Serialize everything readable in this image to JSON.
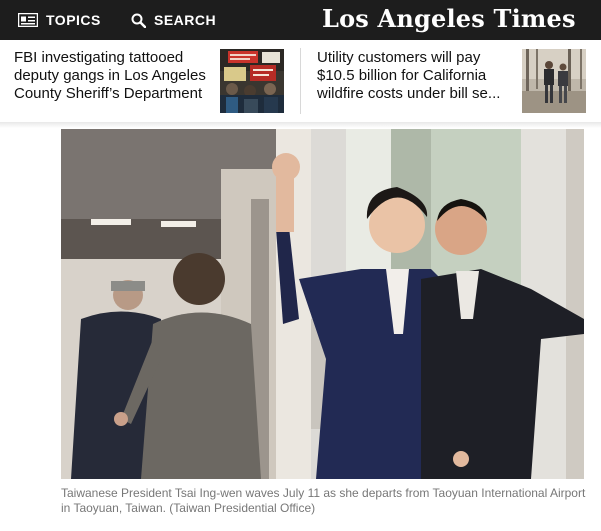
{
  "nav": {
    "topics_label": "TOPICS",
    "search_label": "SEARCH",
    "logo": "Los Angeles Times",
    "bar_color": "#1d1d1d"
  },
  "stories": [
    {
      "headline": "FBI investigating tattooed deputy gangs in Los Angeles County Sheriff’s Department",
      "thumb_icon": "protest-photo"
    },
    {
      "headline": "Utility customers will pay $10.5 billion for California wildfire costs under bill se...",
      "thumb_icon": "people-walking-photo"
    }
  ],
  "article": {
    "photo_icon": "president-waving-photo",
    "caption": "Taiwanese President Tsai Ing-wen waves July 11 as she departs from Taoyuan International Airport in Taoyuan, Taiwan. (Taiwan Presidential Office)"
  }
}
